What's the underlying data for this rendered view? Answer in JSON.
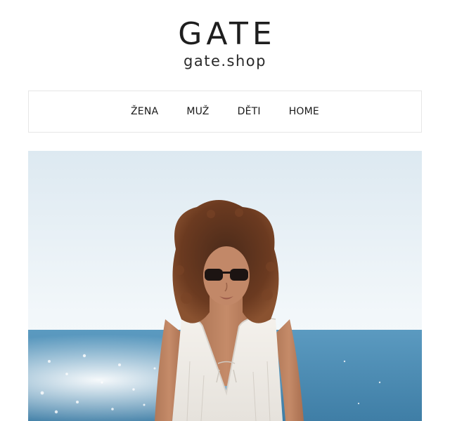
{
  "header": {
    "logo_word": "GATE",
    "logo_domain": "gate.shop"
  },
  "nav": {
    "items": [
      {
        "label": "ŽENA"
      },
      {
        "label": "MUŽ"
      },
      {
        "label": "DĚTI"
      },
      {
        "label": "HOME"
      }
    ]
  },
  "hero": {
    "image_name": "hero-photo"
  },
  "colors": {
    "text": "#1e1e1e",
    "border": "#e6e6e6",
    "sky": "#e9f2f7",
    "sea": "#4f90b6"
  }
}
